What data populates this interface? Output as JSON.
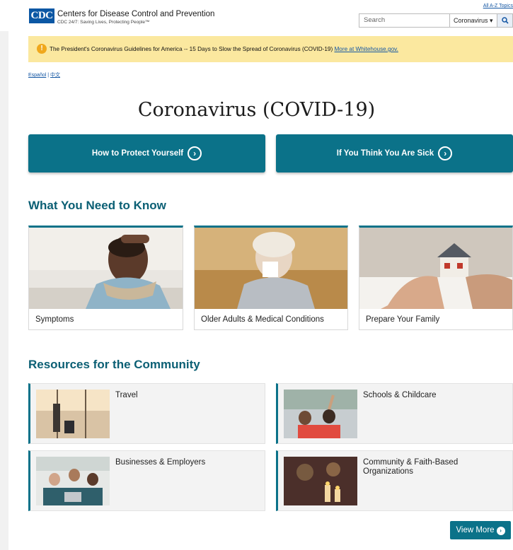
{
  "header": {
    "logo": "CDC",
    "org_name": "Centers for Disease Control and Prevention",
    "tagline": "CDC 24/7: Saving Lives, Protecting People™",
    "az_link": "All A-Z Topics",
    "search_placeholder": "Search",
    "search_scope": "Coronavirus ▾"
  },
  "alert": {
    "text": "The President's Coronavirus Guidelines for America -- 15 Days to Slow the Spread of Coronavirus (COVID-19)",
    "link": "More at Whitehouse.gov."
  },
  "languages": {
    "es": "Español",
    "sep": " | ",
    "zh": "中文"
  },
  "page_title": "Coronavirus (COVID-19)",
  "primary_buttons": {
    "protect": "How to Protect Yourself",
    "sick": "If You Think You Are Sick"
  },
  "know_section": {
    "title": "What You Need to Know",
    "cards": [
      "Symptoms",
      "Older Adults & Medical Conditions",
      "Prepare Your Family"
    ]
  },
  "resources_section": {
    "title": "Resources for the Community",
    "items": [
      "Travel",
      "Schools & Childcare",
      "Businesses & Employers",
      "Community & Faith-Based Organizations"
    ]
  },
  "view_more": "View More",
  "colors": {
    "teal": "#0b7289",
    "heading": "#0b5f74",
    "alert_bg": "#fbe89f",
    "logo_blue": "#0b57a4"
  }
}
